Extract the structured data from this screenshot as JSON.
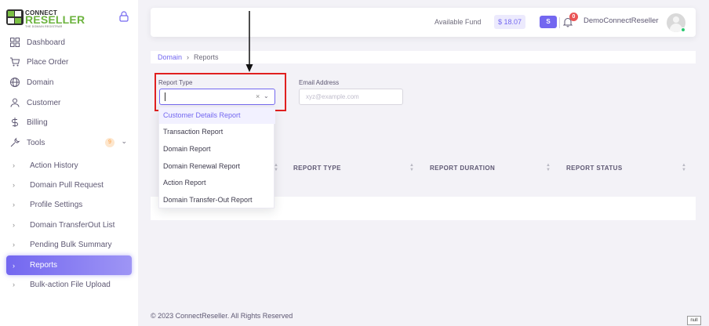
{
  "brand": {
    "line1": "CONNECT",
    "line2": "RESELLER",
    "tagline": "THE DOMAIN REGISTRAR"
  },
  "sidebar": {
    "items": [
      {
        "label": "Dashboard",
        "icon": "grid-icon"
      },
      {
        "label": "Place Order",
        "icon": "cart-icon"
      },
      {
        "label": "Domain",
        "icon": "globe-icon"
      },
      {
        "label": "Customer",
        "icon": "user-icon"
      },
      {
        "label": "Billing",
        "icon": "dollar-icon"
      },
      {
        "label": "Tools",
        "icon": "tool-icon",
        "badge": "9"
      }
    ],
    "subitems": [
      {
        "label": "Action History"
      },
      {
        "label": "Domain Pull Request"
      },
      {
        "label": "Profile Settings"
      },
      {
        "label": "Domain TransferOut List"
      },
      {
        "label": "Pending Bulk Summary"
      },
      {
        "label": "Reports",
        "active": true
      },
      {
        "label": "Bulk-action File Upload"
      }
    ]
  },
  "header": {
    "fund_label": "Available Fund",
    "fund_amount": "$ 18.07",
    "s_button": "S",
    "notification_count": "0",
    "user_name": "DemoConnectReseller"
  },
  "breadcrumb": {
    "link": "Domain",
    "separator": "›",
    "current": "Reports"
  },
  "filters": {
    "report_type_label": "Report Type",
    "clear_symbol": "×",
    "email_label": "Email Address",
    "email_placeholder": "xyz@example.com"
  },
  "dropdown": {
    "options": [
      "Customer Details Report",
      "Transaction Report",
      "Domain Report",
      "Domain Renewal Report",
      "Action Report",
      "Domain Transfer-Out Report"
    ],
    "highlighted_index": 0
  },
  "table": {
    "columns": [
      "REPORT TYPE",
      "REPORT DURATION",
      "REPORT STATUS"
    ]
  },
  "footer": {
    "copyright": "© 2023 ConnectReseller. All Rights Reserved"
  },
  "misc": {
    "null_label": "null"
  },
  "colors": {
    "primary": "#7367f0",
    "highlight_frame": "#e0201f",
    "brand_green": "#6cb33e"
  }
}
